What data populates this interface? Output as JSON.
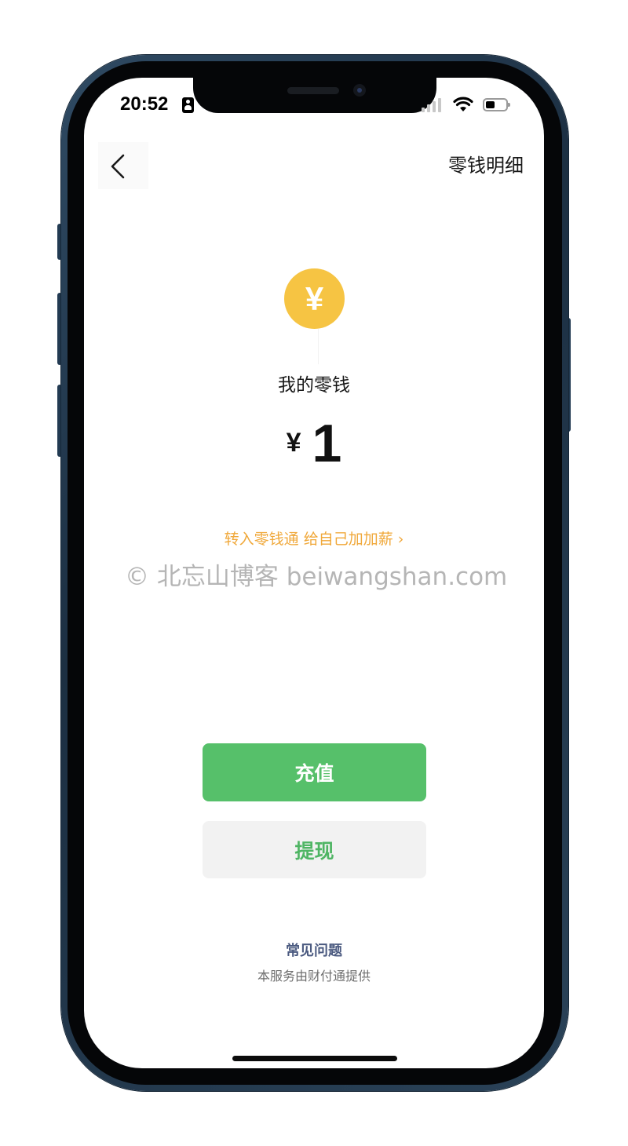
{
  "status_bar": {
    "time": "20:52",
    "icons": [
      "contact-card-icon",
      "signal-icon",
      "wifi-icon",
      "battery-icon"
    ]
  },
  "nav": {
    "back_icon": "chevron-left-icon",
    "detail_label": "零钱明细"
  },
  "wallet": {
    "coin_symbol": "¥",
    "label": "我的零钱",
    "currency_symbol": "¥",
    "amount": "1"
  },
  "promo": {
    "text": "转入零钱通 给自己加加薪 ›"
  },
  "watermark": {
    "text": "© 北忘山博客 beiwangshan.com"
  },
  "actions": {
    "recharge_label": "充值",
    "withdraw_label": "提现"
  },
  "footer": {
    "faq_label": "常见问题",
    "provider_note": "本服务由财付通提供"
  },
  "colors": {
    "accent_green": "#56c06a",
    "coin_yellow": "#f6c443",
    "promo_orange": "#f0a83a",
    "faq_blue": "#4b5a80"
  }
}
